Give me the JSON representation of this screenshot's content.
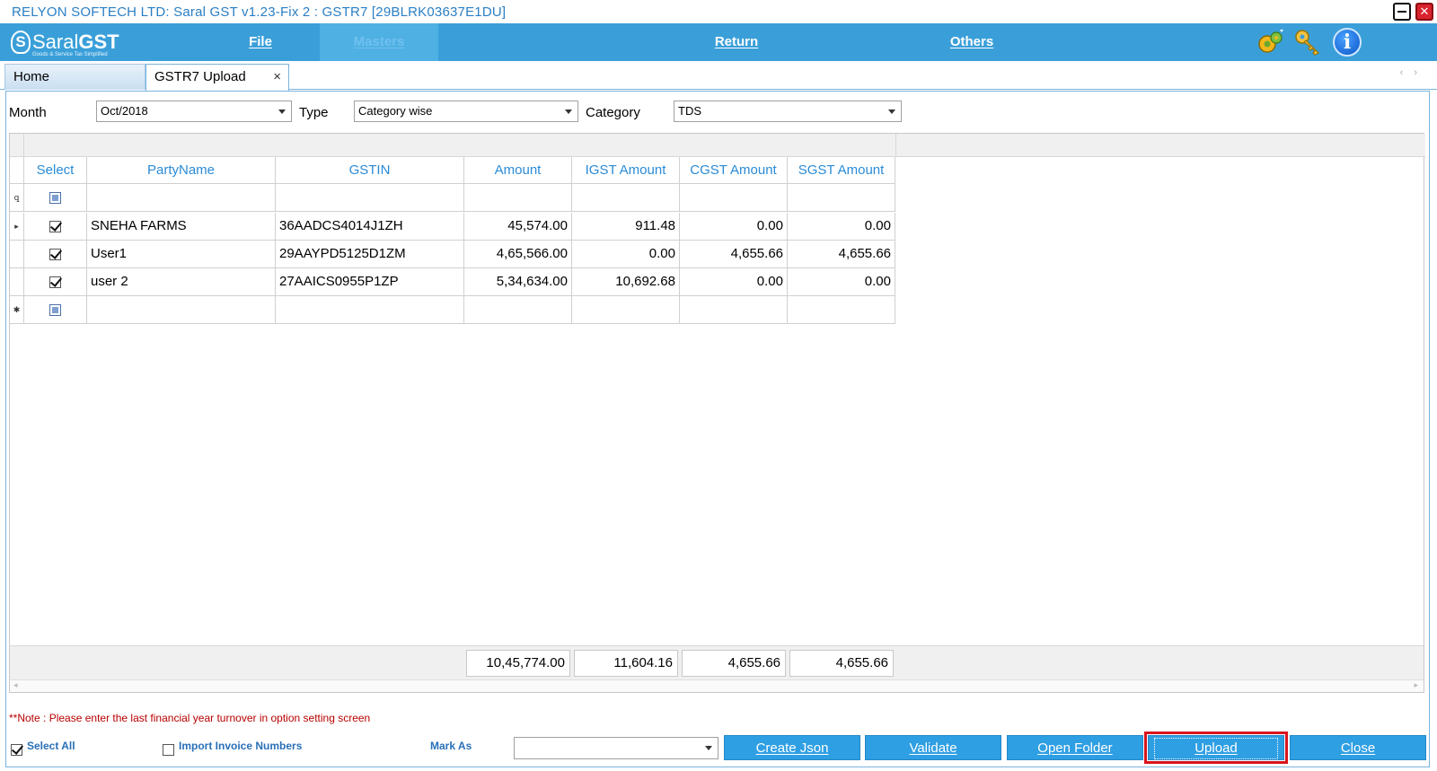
{
  "window": {
    "title": "RELYON SOFTECH LTD: Saral GST v1.23-Fix 2 : GSTR7 [29BLRK03637E1DU]"
  },
  "logo": {
    "name_a": "Saral",
    "name_b": "GST",
    "tagline": "Goods & Service Tax Simplified"
  },
  "menu": {
    "file": "File",
    "masters": "Masters",
    "return": "Return",
    "others": "Others"
  },
  "tabs": {
    "home": "Home",
    "upload": "GSTR7 Upload",
    "close_glyph": "×"
  },
  "filters": {
    "month_label": "Month",
    "month_value": "Oct/2018",
    "type_label": "Type",
    "type_value": "Category wise",
    "category_label": "Category",
    "category_value": "TDS"
  },
  "grid": {
    "columns": [
      "Select",
      "PartyName",
      "GSTIN",
      "Amount",
      "IGST Amount",
      "CGST Amount",
      "SGST Amount"
    ],
    "rows": [
      {
        "selected": true,
        "party": "SNEHA FARMS",
        "gstin": "36AADCS4014J1ZH",
        "amount": "45,574.00",
        "igst": "911.48",
        "cgst": "0.00",
        "sgst": "0.00"
      },
      {
        "selected": true,
        "party": "User1",
        "gstin": "29AAYPD5125D1ZM",
        "amount": "4,65,566.00",
        "igst": "0.00",
        "cgst": "4,655.66",
        "sgst": "4,655.66"
      },
      {
        "selected": true,
        "party": "user 2",
        "gstin": "27AAICS0955P1ZP",
        "amount": "5,34,634.00",
        "igst": "10,692.68",
        "cgst": "0.00",
        "sgst": "0.00"
      }
    ],
    "totals": {
      "amount": "10,45,774.00",
      "igst": "11,604.16",
      "cgst": "4,655.66",
      "sgst": "4,655.66"
    }
  },
  "note": "**Note : Please enter the last financial year turnover in option setting screen",
  "bottom": {
    "select_all": "Select All",
    "select_all_checked": true,
    "import_invoice": "Import Invoice Numbers",
    "import_invoice_checked": false,
    "mark_as": "Mark As",
    "mark_as_value": ""
  },
  "buttons": {
    "create_json": "Create Json",
    "validate": "Validate",
    "open_folder": "Open Folder",
    "upload": "Upload",
    "close": "Close"
  },
  "colors": {
    "menu_bar": "#3a9fd9",
    "button": "#2f9fe3",
    "header_text": "#2a8bd6",
    "highlight": "#d9141e",
    "note": "#b80000"
  },
  "icons": {
    "gear": "gear-icon",
    "key": "key-icon",
    "info": "info-icon"
  }
}
